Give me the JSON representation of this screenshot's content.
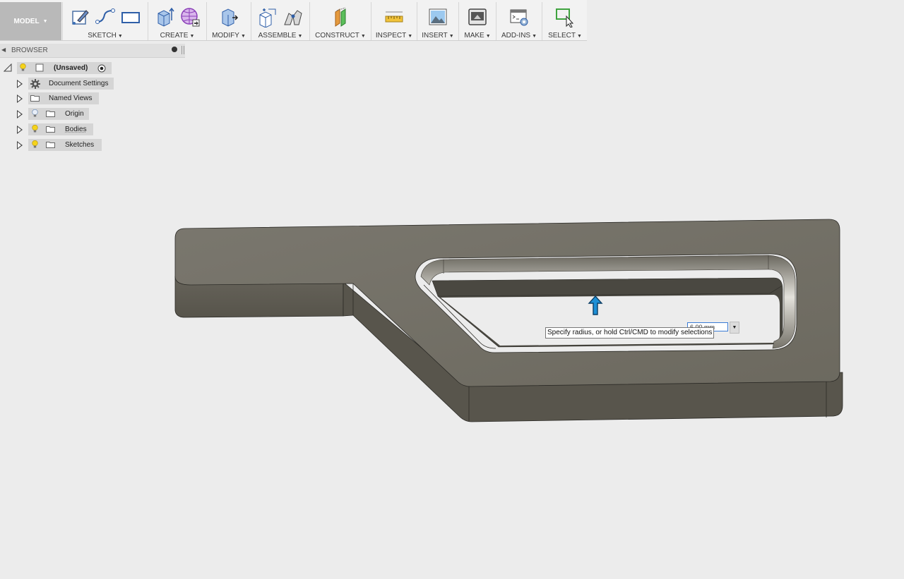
{
  "toolbar": {
    "workspace": {
      "label": "MODEL"
    },
    "groups": [
      {
        "label": "SKETCH"
      },
      {
        "label": "CREATE"
      },
      {
        "label": "MODIFY"
      },
      {
        "label": "ASSEMBLE"
      },
      {
        "label": "CONSTRUCT"
      },
      {
        "label": "INSPECT"
      },
      {
        "label": "INSERT"
      },
      {
        "label": "MAKE"
      },
      {
        "label": "ADD-INS"
      },
      {
        "label": "SELECT"
      }
    ]
  },
  "browser": {
    "title": "BROWSER",
    "root": {
      "label": "(Unsaved)"
    },
    "nodes": [
      {
        "label": "Document Settings",
        "icon": "gear-icon"
      },
      {
        "label": "Named Views",
        "icon": "folder-icon"
      },
      {
        "label": "Origin",
        "icon": "folder-icon"
      },
      {
        "label": "Bodies",
        "icon": "folder-icon"
      },
      {
        "label": "Sketches",
        "icon": "folder-icon"
      }
    ]
  },
  "viewport": {
    "radius_value": "6.00 mm",
    "tooltip": "Specify radius, or hold Ctrl/CMD to modify selections"
  },
  "colors": {
    "part_top": "#76736a",
    "part_side": "#5f5c53",
    "fillet_highlight": "#dedcd6",
    "drag_arrow": "#1e90d6",
    "background": "#ececec"
  }
}
